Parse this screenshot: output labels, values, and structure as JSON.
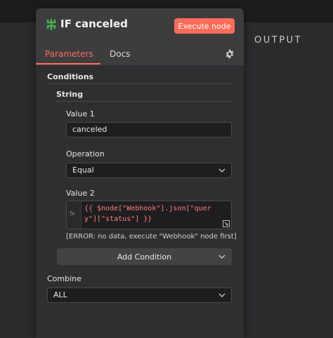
{
  "window": {
    "output_label": "OUTPUT"
  },
  "header": {
    "title": "IF canceled",
    "execute_label": "Execute node",
    "node_icon": "if-branch-icon",
    "accent": "#ff6d5a"
  },
  "tabs": [
    {
      "label": "Parameters",
      "active": true
    },
    {
      "label": "Docs",
      "active": false
    }
  ],
  "settings_icon": "gear-icon",
  "conditions": {
    "section_label": "Conditions",
    "group_label": "String",
    "value1": {
      "label": "Value 1",
      "value": "canceled"
    },
    "operation": {
      "label": "Operation",
      "selected": "Equal"
    },
    "value2": {
      "label": "Value 2",
      "fx": "fx",
      "expression": "{{ $node[\"Webhook\"].json[\"query\"][\"status\"] }}",
      "error": "[ERROR: no data, execute \"Webhook\" node first]"
    },
    "add_condition_label": "Add Condition"
  },
  "combine": {
    "label": "Combine",
    "selected": "ALL"
  }
}
